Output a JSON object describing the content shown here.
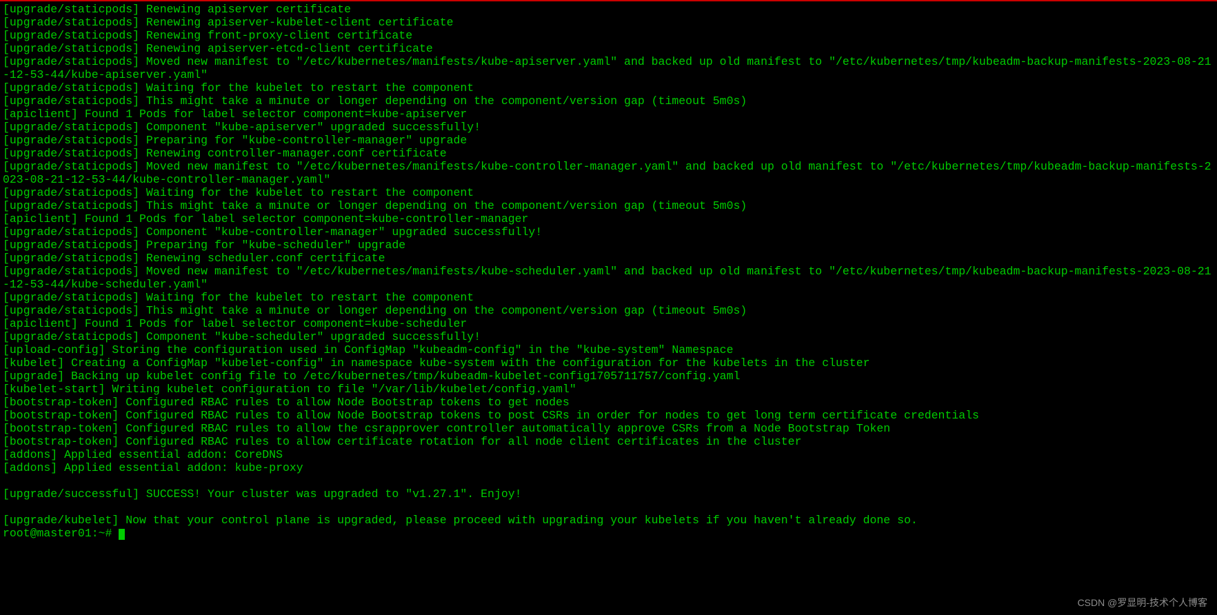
{
  "lines": [
    "[upgrade/staticpods] Renewing apiserver certificate",
    "[upgrade/staticpods] Renewing apiserver-kubelet-client certificate",
    "[upgrade/staticpods] Renewing front-proxy-client certificate",
    "[upgrade/staticpods] Renewing apiserver-etcd-client certificate",
    "[upgrade/staticpods] Moved new manifest to \"/etc/kubernetes/manifests/kube-apiserver.yaml\" and backed up old manifest to \"/etc/kubernetes/tmp/kubeadm-backup-manifests-2023-08-21-12-53-44/kube-apiserver.yaml\"",
    "[upgrade/staticpods] Waiting for the kubelet to restart the component",
    "[upgrade/staticpods] This might take a minute or longer depending on the component/version gap (timeout 5m0s)",
    "[apiclient] Found 1 Pods for label selector component=kube-apiserver",
    "[upgrade/staticpods] Component \"kube-apiserver\" upgraded successfully!",
    "[upgrade/staticpods] Preparing for \"kube-controller-manager\" upgrade",
    "[upgrade/staticpods] Renewing controller-manager.conf certificate",
    "[upgrade/staticpods] Moved new manifest to \"/etc/kubernetes/manifests/kube-controller-manager.yaml\" and backed up old manifest to \"/etc/kubernetes/tmp/kubeadm-backup-manifests-2023-08-21-12-53-44/kube-controller-manager.yaml\"",
    "[upgrade/staticpods] Waiting for the kubelet to restart the component",
    "[upgrade/staticpods] This might take a minute or longer depending on the component/version gap (timeout 5m0s)",
    "[apiclient] Found 1 Pods for label selector component=kube-controller-manager",
    "[upgrade/staticpods] Component \"kube-controller-manager\" upgraded successfully!",
    "[upgrade/staticpods] Preparing for \"kube-scheduler\" upgrade",
    "[upgrade/staticpods] Renewing scheduler.conf certificate",
    "[upgrade/staticpods] Moved new manifest to \"/etc/kubernetes/manifests/kube-scheduler.yaml\" and backed up old manifest to \"/etc/kubernetes/tmp/kubeadm-backup-manifests-2023-08-21-12-53-44/kube-scheduler.yaml\"",
    "[upgrade/staticpods] Waiting for the kubelet to restart the component",
    "[upgrade/staticpods] This might take a minute or longer depending on the component/version gap (timeout 5m0s)",
    "[apiclient] Found 1 Pods for label selector component=kube-scheduler",
    "[upgrade/staticpods] Component \"kube-scheduler\" upgraded successfully!",
    "[upload-config] Storing the configuration used in ConfigMap \"kubeadm-config\" in the \"kube-system\" Namespace",
    "[kubelet] Creating a ConfigMap \"kubelet-config\" in namespace kube-system with the configuration for the kubelets in the cluster",
    "[upgrade] Backing up kubelet config file to /etc/kubernetes/tmp/kubeadm-kubelet-config1705711757/config.yaml",
    "[kubelet-start] Writing kubelet configuration to file \"/var/lib/kubelet/config.yaml\"",
    "[bootstrap-token] Configured RBAC rules to allow Node Bootstrap tokens to get nodes",
    "[bootstrap-token] Configured RBAC rules to allow Node Bootstrap tokens to post CSRs in order for nodes to get long term certificate credentials",
    "[bootstrap-token] Configured RBAC rules to allow the csrapprover controller automatically approve CSRs from a Node Bootstrap Token",
    "[bootstrap-token] Configured RBAC rules to allow certificate rotation for all node client certificates in the cluster",
    "[addons] Applied essential addon: CoreDNS",
    "[addons] Applied essential addon: kube-proxy",
    "",
    "[upgrade/successful] SUCCESS! Your cluster was upgraded to \"v1.27.1\". Enjoy!",
    "",
    "[upgrade/kubelet] Now that your control plane is upgraded, please proceed with upgrading your kubelets if you haven't already done so."
  ],
  "prompt": "root@master01:~# ",
  "watermark": "CSDN @罗显明-技术个人博客"
}
